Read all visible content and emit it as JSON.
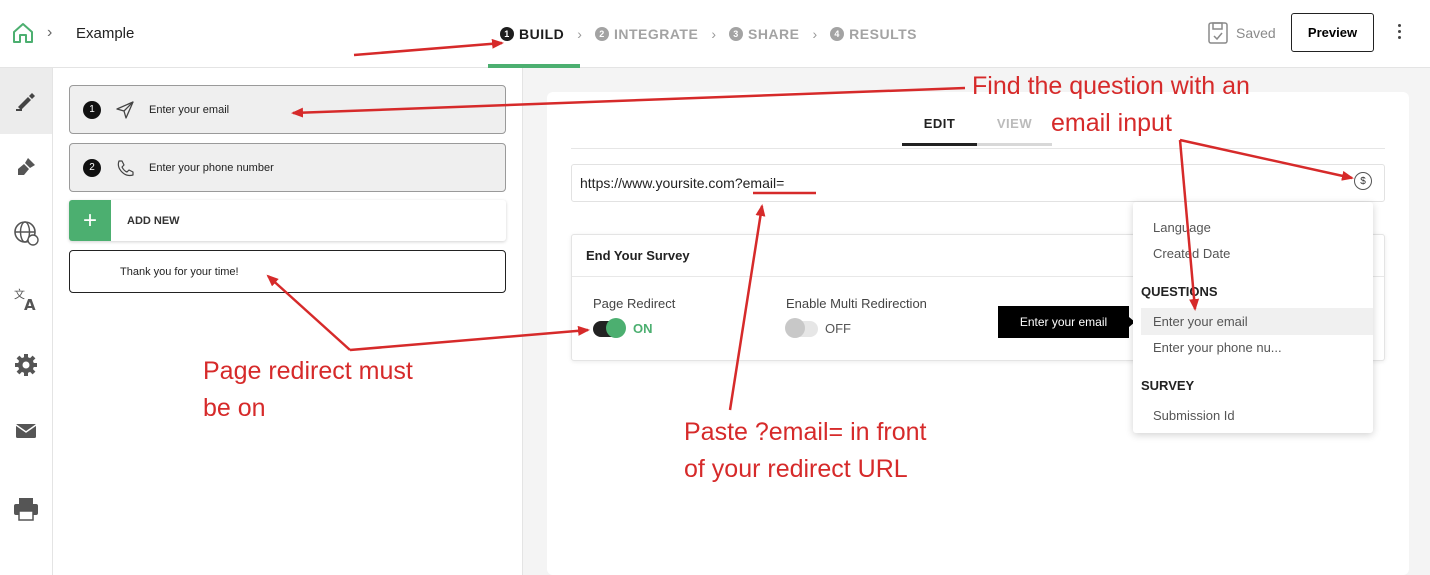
{
  "header": {
    "breadcrumb_title": "Example",
    "steps": [
      {
        "num": "1",
        "label": "BUILD"
      },
      {
        "num": "2",
        "label": "INTEGRATE"
      },
      {
        "num": "3",
        "label": "SHARE"
      },
      {
        "num": "4",
        "label": "RESULTS"
      }
    ],
    "saved_label": "Saved",
    "preview_label": "Preview"
  },
  "questions": [
    {
      "num": "1",
      "label": "Enter your email",
      "icon": "send-icon"
    },
    {
      "num": "2",
      "label": "Enter your phone number",
      "icon": "phone-icon"
    }
  ],
  "add_new_label": "ADD NEW",
  "thank_you_label": "Thank you for your time!",
  "editor": {
    "tabs": [
      "EDIT",
      "VIEW"
    ],
    "url_value_base": "https://www.yoursite.com",
    "url_value_param": "?email=",
    "var_icon_label": "$"
  },
  "end_survey": {
    "title": "End Your Survey",
    "page_redirect_label": "Page Redirect",
    "page_redirect_state": "ON",
    "multi_redirect_label": "Enable Multi Redirection",
    "multi_redirect_state": "OFF"
  },
  "tooltip": "Enter your email",
  "dropdown": {
    "general": [
      "Language",
      "Created Date"
    ],
    "questions_header": "QUESTIONS",
    "questions": [
      "Enter your email",
      "Enter your phone nu..."
    ],
    "survey_header": "SURVEY",
    "survey": [
      "Submission Id"
    ]
  },
  "annotations": {
    "find_question": [
      "Find the question with an",
      "email input"
    ],
    "page_redirect": [
      "Page redirect must",
      "be on"
    ],
    "paste_email": [
      "Paste ?email= in front",
      "of your redirect URL"
    ]
  },
  "colors": {
    "accent_green": "#4caf70",
    "annotation_red": "#d62a2a"
  }
}
